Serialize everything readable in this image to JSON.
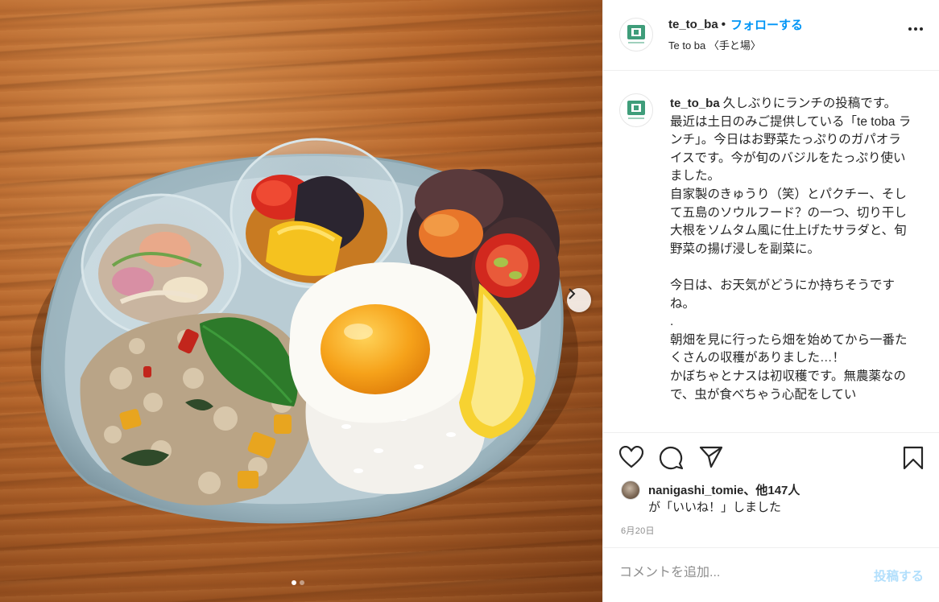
{
  "post": {
    "username": "te_to_ba",
    "follow_label": "フォローする",
    "separator": "•",
    "location": "Te to ba 〈手と場〉",
    "logo_text": "te to ba"
  },
  "caption": {
    "username": "te_to_ba",
    "text": "久しぶりにランチの投稿です。\n最近は土日のみご提供している「te toba ランチ」。今日はお野菜たっぷりのガパオライスです。今が旬のバジルをたっぷり使いました。\n自家製のきゅうり（笑）とパクチー、そして五島のソウルフード？の一つ、切り干し大根をソムタム風に仕上げたサラダと、旬野菜の揚げ浸しを副菜に。\n\n今日は、お天気がどうにか持ちそうですね。\n.\n朝畑を見に行ったら畑を始めてから一番たくさんの収穫がありました…！\nかぼちゃとナスは初収穫です。無農薬なので、虫が食べちゃう心配をしてい"
  },
  "likes": {
    "user": "nanigashi_tomie",
    "others": "、他147人",
    "line2": "が「いいね！」しました"
  },
  "date": "6月20日",
  "comment": {
    "placeholder": "コメントを追加...",
    "post_label": "投稿する"
  },
  "icons": {
    "like": "heart-icon",
    "comment": "comment-icon",
    "share": "share-icon",
    "save": "bookmark-icon",
    "more": "more-icon",
    "next": "chevron-right-icon"
  },
  "carousel": {
    "current": 1,
    "total": 2
  },
  "colors": {
    "accent": "#0095f6",
    "post_disabled": "#b2dffc",
    "logo_green": "#3f9d7a"
  }
}
